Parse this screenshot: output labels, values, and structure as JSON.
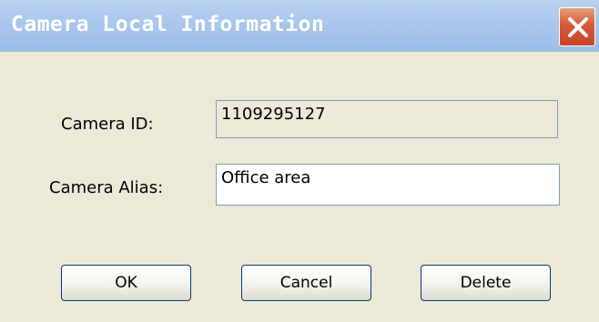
{
  "window": {
    "title": "Camera Local Information",
    "close_icon": "close-icon"
  },
  "form": {
    "camera_id_label": "Camera ID:",
    "camera_id_value": "1109295127",
    "camera_alias_label": "Camera Alias:",
    "camera_alias_value": "Office area"
  },
  "buttons": {
    "ok_label": "OK",
    "cancel_label": "Cancel",
    "delete_label": "Delete"
  },
  "colors": {
    "titlebar": "#a9c6ec",
    "close_button": "#d8583a",
    "dialog_background": "#ece9d8"
  }
}
